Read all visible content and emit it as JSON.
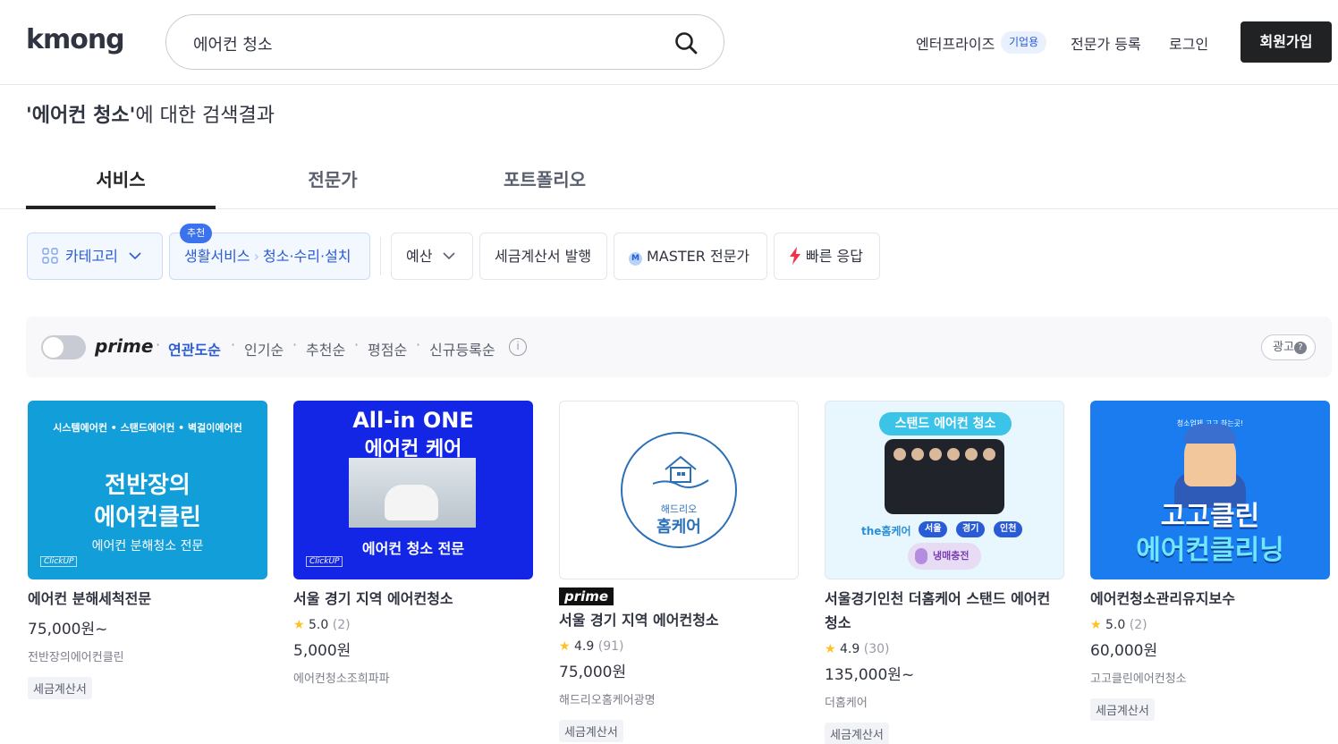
{
  "header": {
    "logo": "kmong",
    "search_value": "에어컨 청소",
    "nav_enterprise": "엔터프라이즈",
    "enterprise_badge": "기업용",
    "nav_expert_register": "전문가 등록",
    "nav_login": "로그인",
    "signup_button": "회원가입"
  },
  "result": {
    "query_quoted": "'에어컨 청소'",
    "suffix": "에 대한 검색결과"
  },
  "tabs": [
    {
      "label": "서비스",
      "active": true
    },
    {
      "label": "전문가",
      "active": false
    },
    {
      "label": "포트폴리오",
      "active": false
    }
  ],
  "filters": {
    "category": "카테고리",
    "recommend_badge": "추천",
    "breadcrumb_parent": "생활서비스",
    "breadcrumb_child": "청소·수리·설치",
    "budget": "예산",
    "tax_invoice": "세금계산서 발행",
    "master": "MASTER 전문가",
    "fast_response": "빠른 응답"
  },
  "sortbar": {
    "prime_label": "prime",
    "options": [
      "연관도순",
      "인기순",
      "추천순",
      "평점순",
      "신규등록순"
    ],
    "active": "연관도순",
    "ad_label": "광고"
  },
  "cards": [
    {
      "thumb_top": "시스템에어컨 • 스탠드에어컨 • 벽걸이에어컨",
      "thumb_line1": "전반장의",
      "thumb_line2": "에어컨클린",
      "thumb_line3": "에어컨 분해청소 전문",
      "thumb_badge": "ClickUP",
      "title": "에어컨 분해세척전문",
      "price": "75,000원~",
      "seller": "전반장의에어컨클린",
      "tag": "세금계산서"
    },
    {
      "thumb_line1": "All-in ONE",
      "thumb_line2": "에어컨 케어",
      "thumb_line3": "에어컨 청소 전문",
      "thumb_badge": "ClickUP",
      "title": "서울 경기 지역 에어컨청소",
      "rating": "5.0",
      "rating_count": "(2)",
      "price": "5,000원",
      "seller": "에어컨청소조희파파"
    },
    {
      "thumb_small": "해드리오",
      "thumb_big": "홈케어",
      "prime_tag": "prime",
      "title": "서울 경기 지역 에어컨청소",
      "rating": "4.9",
      "rating_count": "(91)",
      "price": "75,000원",
      "seller": "해드리오홈케어광명",
      "tag": "세금계산서"
    },
    {
      "thumb_pill": "스탠드 에어컨 청소",
      "thumb_brand": "the홈케어",
      "thumb_regions": [
        "서울",
        "경기",
        "인천"
      ],
      "thumb_fridge": "냉매충전",
      "title_line1": "서울경기인천 더홈케어 스탠드 에어컨",
      "title_line2": "청소",
      "rating": "4.9",
      "rating_count": "(30)",
      "price": "135,000원~",
      "seller": "더홈케어",
      "tag": "세금계산서"
    },
    {
      "thumb_small": "청소업체 고고 하는곳!",
      "thumb_line1": "고고클린",
      "thumb_line2": "에어컨클리닝",
      "title": "에어컨청소관리유지보수",
      "rating": "5.0",
      "rating_count": "(2)",
      "price": "60,000원",
      "seller": "고고클린에어컨청소",
      "tag": "세금계산서"
    }
  ],
  "colors": {
    "accent_blue": "#2a5bd7",
    "signup_bg": "#212224",
    "star": "#ffc021"
  }
}
